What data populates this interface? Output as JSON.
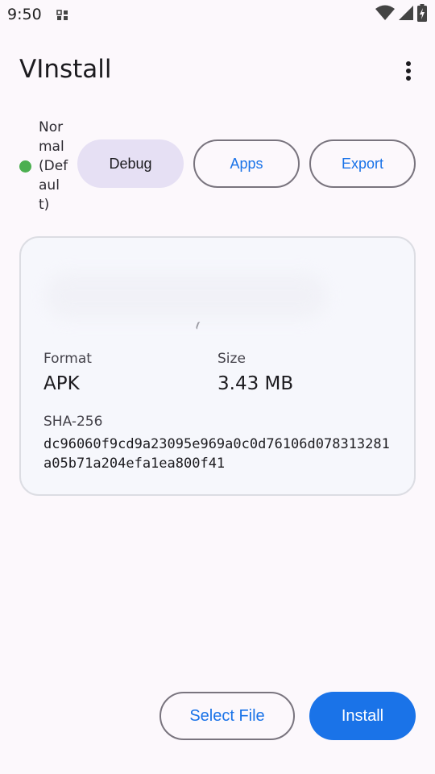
{
  "status_bar": {
    "time": "9:50",
    "notification_icon": "grid-icon",
    "icons": [
      "wifi-icon",
      "signal-icon",
      "battery-charging-icon"
    ]
  },
  "app_bar": {
    "title": "VInstall",
    "menu_icon": "more-vert-icon"
  },
  "mode": {
    "label": "Normal (Default)",
    "status_color": "#4caf50"
  },
  "chips": {
    "debug": "Debug",
    "apps": "Apps",
    "export": "Export"
  },
  "file_info": {
    "format_label": "Format",
    "format_value": "APK",
    "size_label": "Size",
    "size_value": "3.43 MB",
    "sha_label": "SHA-256",
    "sha_value": "dc96060f9cd9a23095e969a0c0d76106d078313281a05b71a204efa1ea800f41"
  },
  "actions": {
    "select_file": "Select File",
    "install": "Install"
  },
  "colors": {
    "accent": "#1a73e8",
    "filled_chip": "#e6e0f4",
    "background": "#fcf8fc"
  }
}
